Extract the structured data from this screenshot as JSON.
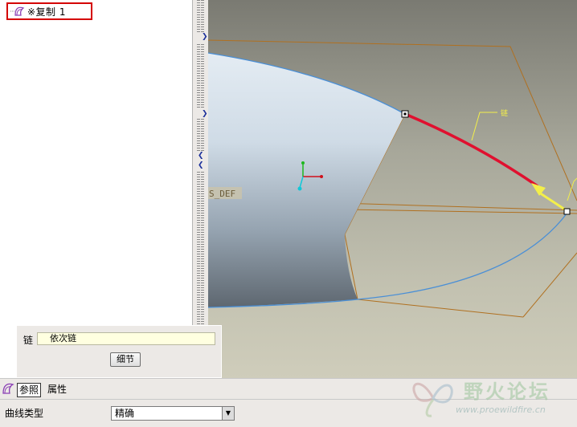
{
  "tree": {
    "item_label": "※复制 1"
  },
  "viewport": {
    "csys_label": "S_DEF",
    "callout_label": "链",
    "colors": {
      "edge_highlight": "#e0102f",
      "callout": "#f3ef4a",
      "frame": "#b07020"
    }
  },
  "dashboard": {
    "chain_label": "链",
    "chain_value": "依次链",
    "details_label": "细节"
  },
  "tabs": [
    {
      "label": "参照",
      "active": true
    },
    {
      "label": "属性",
      "active": false
    }
  ],
  "properties": {
    "curve_type_label": "曲线类型",
    "curve_type_value": "精确"
  },
  "watermark": {
    "title": "野火论坛",
    "url": "www.proewildfire.cn"
  }
}
